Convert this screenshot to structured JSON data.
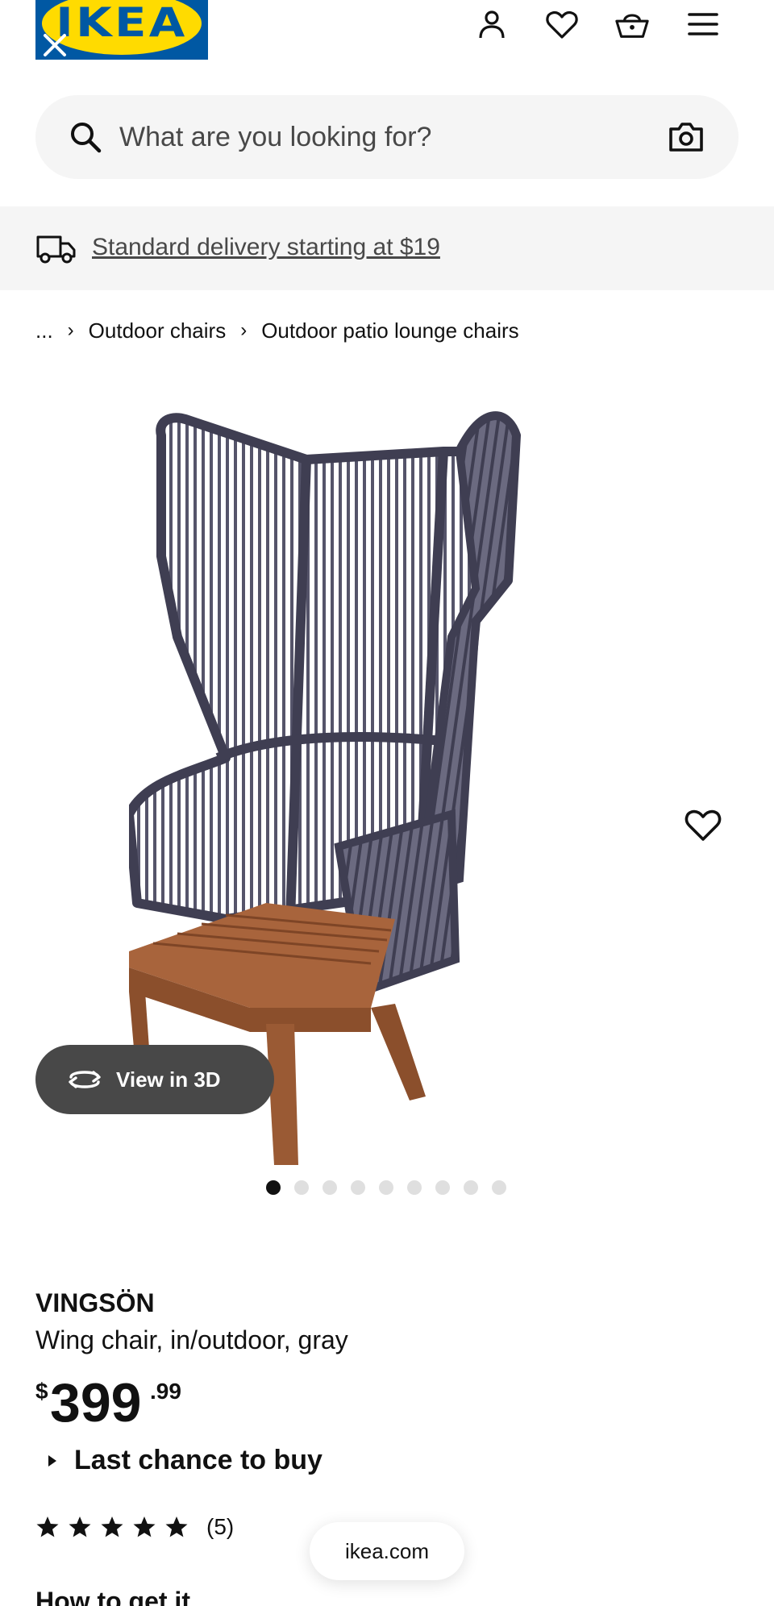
{
  "header": {
    "logo_text": "IKEA",
    "icons": [
      "user-icon",
      "heart-icon",
      "basket-icon",
      "hamburger-menu-icon"
    ]
  },
  "search": {
    "placeholder": "What are you looking for?",
    "icon": "search-icon",
    "camera_icon": "camera-icon"
  },
  "delivery": {
    "text": "Standard delivery starting at $19",
    "icon": "truck-icon"
  },
  "breadcrumb": {
    "ellipsis": "...",
    "items": [
      "Outdoor chairs",
      "Outdoor patio lounge chairs"
    ],
    "separator": "›"
  },
  "gallery": {
    "view3d_label": "View in 3D",
    "dot_count": 9,
    "active_index": 0
  },
  "product": {
    "name": "VINGSÖN",
    "description": "Wing chair, in/outdoor, gray",
    "price": {
      "currency": "$",
      "integer": "399",
      "decimal": ".99"
    },
    "last_chance": "Last chance to buy",
    "rating": {
      "stars": 5,
      "count": "(5)"
    },
    "next_heading": "How to get it"
  },
  "browser": {
    "url": "ikea.com"
  },
  "colors": {
    "ikea_blue": "#0058a3",
    "ikea_yellow": "#ffdb00",
    "banner_gray": "#f5f5f5",
    "text_dark": "#111111",
    "pill_dark": "#484848"
  }
}
